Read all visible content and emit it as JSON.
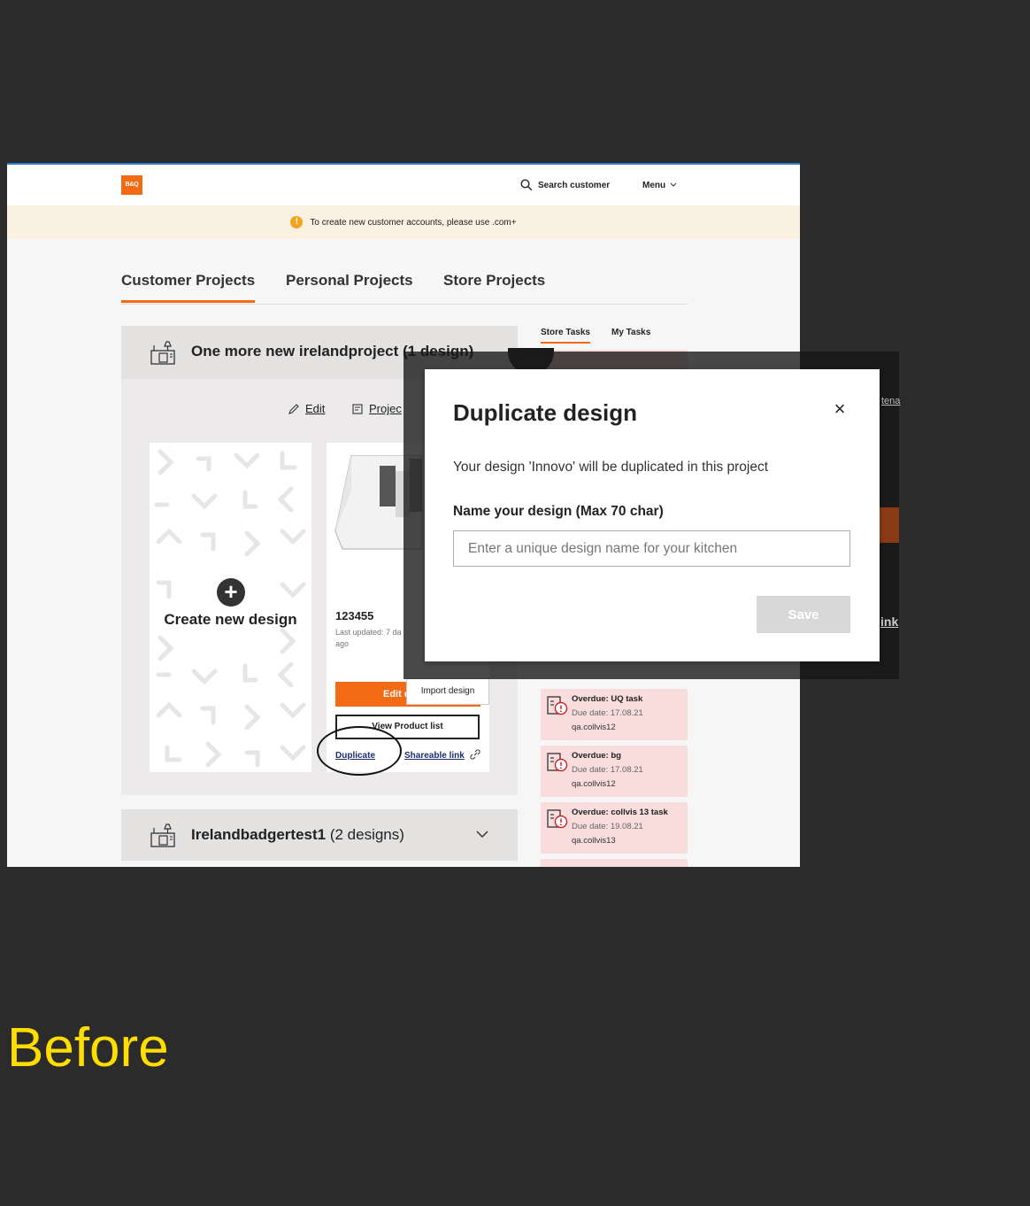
{
  "header": {
    "logo_text": "B&Q",
    "search_label": "Search customer",
    "menu_label": "Menu"
  },
  "notice": {
    "icon": "!",
    "text": "To create new customer accounts, please use .com+"
  },
  "tabs": [
    "Customer Projects",
    "Personal Projects",
    "Store Projects"
  ],
  "project": {
    "title": "One more new irelandproject (1 design)",
    "edit_label": "Edit",
    "project_label": "Projec",
    "create_label": "Create new design",
    "design": {
      "name": "123455",
      "updated": "Last updated: 7 da",
      "updated_2": "ago",
      "edit_button": "Edit d",
      "import_label": "Import design",
      "view_products": "View Product list",
      "duplicate": "Duplicate",
      "shareable": "Shareable link"
    }
  },
  "project2": {
    "title_bold": "Irelandbadgertest1",
    "title_rest": " (2 designs)"
  },
  "tasks": {
    "tab_store": "Store Tasks",
    "tab_mine": "My Tasks",
    "items": [
      {
        "title": "Overdue: UQ task",
        "due": "Due date: 17.08.21",
        "user": "qa.collvis12"
      },
      {
        "title": "Overdue: bg",
        "due": "Due date: 17.08.21",
        "user": "qa.collvis12"
      },
      {
        "title": "Overdue: collvis 13 task",
        "due": "Due date: 19.08.21",
        "user": "qa.collvis13"
      }
    ]
  },
  "modal": {
    "title": "Duplicate design",
    "close": "×",
    "description": "Your design 'Innovo' will be duplicated in this project",
    "label": "Name your design (Max 70 char)",
    "placeholder": "Enter a unique design name for your kitchen",
    "value": "",
    "save": "Save"
  },
  "sliver_text": {
    "top": "tena",
    "bottom": "ink"
  },
  "caption": "Before",
  "colors": {
    "brand_orange": "#f36a14",
    "background": "#2b2b2b",
    "caption": "#ffdd00",
    "task_bg": "#f9dcdc"
  }
}
